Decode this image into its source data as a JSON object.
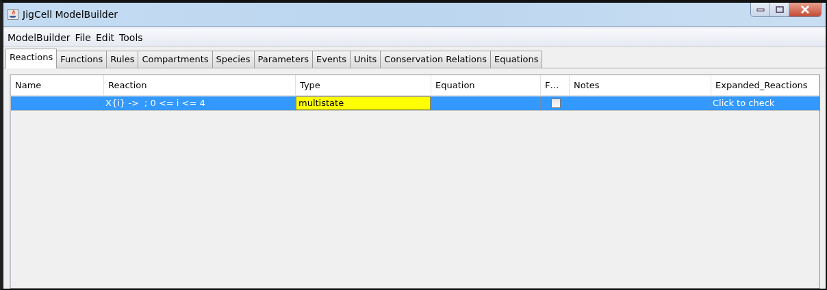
{
  "window": {
    "title": "JigCell ModelBuilder"
  },
  "menu": [
    "ModelBuilder",
    "File",
    "Edit",
    "Tools"
  ],
  "tabs": [
    {
      "label": "Reactions",
      "selected": true
    },
    {
      "label": "Functions",
      "selected": false
    },
    {
      "label": "Rules",
      "selected": false
    },
    {
      "label": "Compartments",
      "selected": false
    },
    {
      "label": "Species",
      "selected": false
    },
    {
      "label": "Parameters",
      "selected": false
    },
    {
      "label": "Events",
      "selected": false
    },
    {
      "label": "Units",
      "selected": false
    },
    {
      "label": "Conservation Relations",
      "selected": false
    },
    {
      "label": "Equations",
      "selected": false
    }
  ],
  "table": {
    "columns": [
      "Name",
      "Reaction",
      "Type",
      "Equation",
      "F…",
      "Notes",
      "Expanded_Reactions"
    ],
    "rows": [
      {
        "selected": true,
        "name": "",
        "reaction": "X{i} ->  ; 0 <= i <= 4",
        "type": "multistate",
        "type_focused": true,
        "equation": "",
        "f_checked": false,
        "notes": "",
        "expanded_reactions": "Click to check"
      }
    ]
  }
}
